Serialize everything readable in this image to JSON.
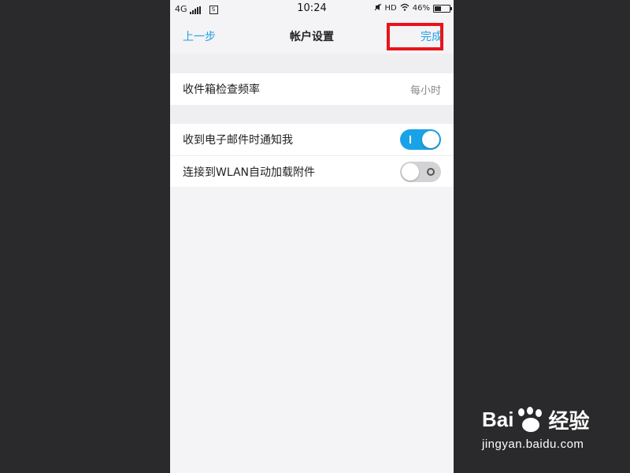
{
  "status_bar": {
    "network": "4G",
    "time": "10:24",
    "hd": "HD",
    "battery_percent_label": "46%",
    "battery_level": 0.46
  },
  "nav": {
    "back_label": "上一步",
    "title": "帐户设置",
    "done_label": "完成"
  },
  "settings": {
    "check_frequency": {
      "label": "收件箱检查频率",
      "value": "每小时"
    },
    "notify_on_email": {
      "label": "收到电子邮件时通知我",
      "enabled": true
    },
    "wlan_auto_download": {
      "label": "连接到WLAN自动加载附件",
      "enabled": false
    }
  },
  "colors": {
    "accent": "#1aa2e6",
    "highlight": "#e8141a"
  },
  "watermark": {
    "brand_left": "Bai",
    "brand_right": "经验",
    "url": "jingyan.baidu.com"
  }
}
